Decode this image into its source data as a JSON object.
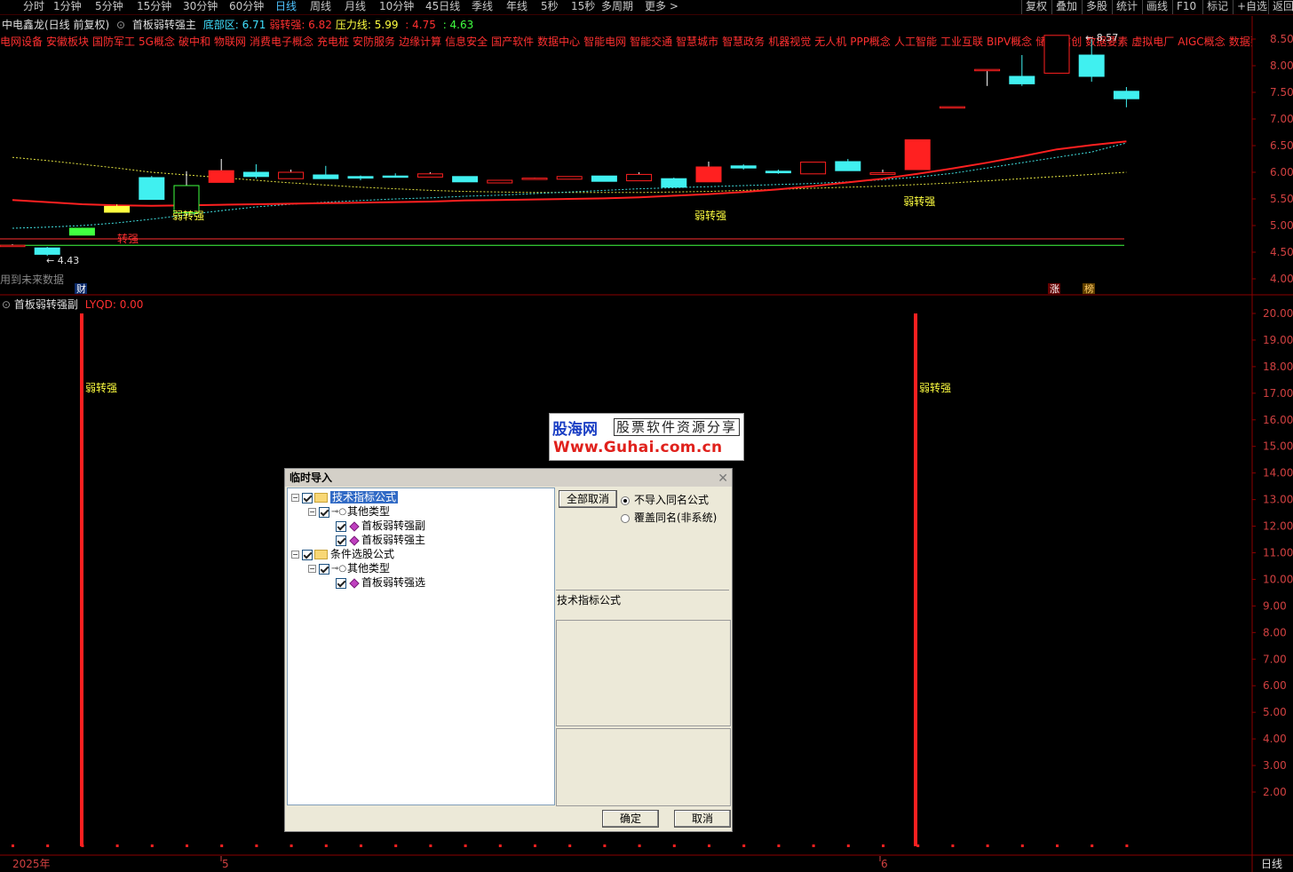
{
  "toolbar": {
    "periods": [
      "分时",
      "1分钟",
      "5分钟",
      "15分钟",
      "30分钟",
      "60分钟",
      "日线",
      "周线",
      "月线",
      "10分钟",
      "45日线",
      "季线",
      "年线",
      "5秒",
      "15秒",
      "多周期",
      "更多 >"
    ],
    "active_period": "日线",
    "right_buttons": [
      "复权",
      "叠加",
      "多股",
      "统计",
      "画线",
      "F10",
      "标记",
      "+自选",
      "返回"
    ]
  },
  "main_chart": {
    "stock": "中电鑫龙(日线 前复权)",
    "indicator": "首板弱转强主",
    "fields": [
      {
        "label": "底部区:",
        "value": "6.71",
        "color": "#40e0ff"
      },
      {
        "label": "弱转强:",
        "value": "6.82",
        "color": "#ff3030"
      },
      {
        "label": "压力线:",
        "value": "5.99",
        "color": "#ffff40"
      },
      {
        "label": "",
        "value": ": 4.75",
        "color": "#ff3030"
      },
      {
        "label": "",
        "value": ": 4.63",
        "color": "#40ff40"
      }
    ],
    "concepts": [
      "电网设备",
      "安徽板块",
      "国防军工",
      "5G概念",
      "破中和",
      "物联网",
      "消费电子概念",
      "充电桩",
      "安防服务",
      "边缘计算",
      "信息安全",
      "国产软件",
      "数据中心",
      "智能电网",
      "智能交通",
      "智慧城市",
      "智慧政务",
      "机器视觉",
      "无人机",
      "PPP概念",
      "人工智能",
      "工业互联",
      "BIPV概念",
      "储能",
      "信创",
      "数据要素",
      "虚拟电厂",
      "AIGC概念",
      "数据要素"
    ],
    "price_axis": [
      "8.50",
      "8.00",
      "7.50",
      "7.00",
      "6.50",
      "6.00",
      "5.50",
      "5.00",
      "4.50",
      "4.00"
    ],
    "signals": {
      "weak_to_strong": "弱转强",
      "turn_strong": "转强"
    },
    "high_label": "8.57",
    "low_label": "4.43",
    "future_note": "用到未来数据",
    "fin_marker": "财",
    "up_marker": "涨",
    "list_marker": "榜"
  },
  "sub_chart": {
    "indicator": "首板弱转强副",
    "field": "LYQD: 0.00",
    "axis": [
      "20.00",
      "19.00",
      "18.00",
      "17.00",
      "16.00",
      "15.00",
      "14.00",
      "13.00",
      "12.00",
      "11.00",
      "10.00",
      "9.00",
      "8.00",
      "7.00",
      "6.00",
      "5.00",
      "4.00",
      "3.00",
      "2.00"
    ],
    "signal_label": "弱转强"
  },
  "time_axis": {
    "year": "2025年",
    "m5": "5",
    "m6": "6",
    "period": "日线"
  },
  "watermark": {
    "brand": "股海网",
    "slogan": "股票软件资源分享",
    "url": "Www.Guhai.com.cn"
  },
  "dialog": {
    "title": "临时导入",
    "tree": [
      {
        "label": "技术指标公式",
        "level": 0,
        "kind": "folder",
        "selected": true
      },
      {
        "label": "其他类型",
        "level": 1,
        "kind": "key"
      },
      {
        "label": "首板弱转强副",
        "level": 2,
        "kind": "formula"
      },
      {
        "label": "首板弱转强主",
        "level": 2,
        "kind": "formula"
      },
      {
        "label": "条件选股公式",
        "level": 0,
        "kind": "folder"
      },
      {
        "label": "其他类型",
        "level": 1,
        "kind": "key"
      },
      {
        "label": "首板弱转强选",
        "level": 2,
        "kind": "formula"
      }
    ],
    "cancel_all": "全部取消",
    "radio_no_import": "不导入同名公式",
    "radio_overwrite": "覆盖同名(非系统)",
    "desc_title": "技术指标公式",
    "ok": "确定",
    "cancel": "取消"
  },
  "colors": {
    "up": "#ff2020",
    "down": "#40f0f0",
    "ma_red": "#ff2020",
    "ma_cyan": "#40e0e0",
    "ma_yellow": "#e0e040"
  },
  "chart_data": {
    "type": "candlestick",
    "candles": [
      {
        "o": 4.62,
        "h": 4.65,
        "l": 4.6,
        "c": 4.63
      },
      {
        "o": 4.58,
        "h": 4.6,
        "l": 4.43,
        "c": 4.46
      },
      {
        "o": 4.95,
        "h": 4.96,
        "l": 4.82,
        "c": 4.82
      },
      {
        "o": 5.36,
        "h": 5.4,
        "l": 5.25,
        "c": 5.25
      },
      {
        "o": 5.9,
        "h": 5.93,
        "l": 5.49,
        "c": 5.49
      },
      {
        "o": 5.24,
        "h": 6.02,
        "l": 5.18,
        "c": 5.75
      },
      {
        "o": 5.81,
        "h": 6.25,
        "l": 5.81,
        "c": 6.03
      },
      {
        "o": 6.0,
        "h": 6.15,
        "l": 5.88,
        "c": 5.92
      },
      {
        "o": 5.88,
        "h": 6.05,
        "l": 5.88,
        "c": 6.0
      },
      {
        "o": 5.95,
        "h": 6.12,
        "l": 5.88,
        "c": 5.88
      },
      {
        "o": 5.92,
        "h": 5.94,
        "l": 5.85,
        "c": 5.89
      },
      {
        "o": 5.93,
        "h": 5.98,
        "l": 5.9,
        "c": 5.92
      },
      {
        "o": 5.91,
        "h": 6.0,
        "l": 5.91,
        "c": 5.97
      },
      {
        "o": 5.92,
        "h": 5.92,
        "l": 5.82,
        "c": 5.82
      },
      {
        "o": 5.8,
        "h": 5.85,
        "l": 5.8,
        "c": 5.85
      },
      {
        "o": 5.88,
        "h": 5.9,
        "l": 5.88,
        "c": 5.89
      },
      {
        "o": 5.87,
        "h": 5.92,
        "l": 5.87,
        "c": 5.92
      },
      {
        "o": 5.93,
        "h": 5.93,
        "l": 5.83,
        "c": 5.83
      },
      {
        "o": 5.84,
        "h": 6.0,
        "l": 5.84,
        "c": 5.96
      },
      {
        "o": 5.88,
        "h": 5.9,
        "l": 5.72,
        "c": 5.72
      },
      {
        "o": 5.82,
        "h": 6.2,
        "l": 5.82,
        "c": 6.1
      },
      {
        "o": 6.12,
        "h": 6.15,
        "l": 6.05,
        "c": 6.08
      },
      {
        "o": 6.02,
        "h": 6.05,
        "l": 5.97,
        "c": 5.99
      },
      {
        "o": 5.97,
        "h": 6.19,
        "l": 5.97,
        "c": 6.19
      },
      {
        "o": 6.2,
        "h": 6.25,
        "l": 6.03,
        "c": 6.03
      },
      {
        "o": 5.96,
        "h": 6.05,
        "l": 5.96,
        "c": 5.99
      },
      {
        "o": 6.05,
        "h": 6.61,
        "l": 6.05,
        "c": 6.61
      },
      {
        "o": 7.23,
        "h": 7.23,
        "l": 7.23,
        "c": 7.23
      },
      {
        "o": 7.93,
        "h": 7.93,
        "l": 7.62,
        "c": 7.93
      },
      {
        "o": 7.8,
        "h": 8.2,
        "l": 7.62,
        "c": 7.66
      },
      {
        "o": 7.86,
        "h": 8.57,
        "l": 7.86,
        "c": 8.57
      },
      {
        "o": 8.2,
        "h": 8.5,
        "l": 7.7,
        "c": 7.8
      },
      {
        "o": 7.52,
        "h": 7.6,
        "l": 7.22,
        "c": 7.38
      }
    ],
    "ma_red": [
      5.48,
      5.44,
      5.4,
      5.38,
      5.37,
      5.38,
      5.39,
      5.4,
      5.41,
      5.42,
      5.43,
      5.44,
      5.45,
      5.47,
      5.48,
      5.49,
      5.5,
      5.51,
      5.53,
      5.56,
      5.59,
      5.63,
      5.68,
      5.74,
      5.81,
      5.88,
      5.97,
      6.07,
      6.18,
      6.3,
      6.43,
      6.51,
      6.58
    ],
    "ma_cyan": [
      4.95,
      4.97,
      5.0,
      5.05,
      5.12,
      5.2,
      5.28,
      5.35,
      5.4,
      5.44,
      5.47,
      5.5,
      5.52,
      5.55,
      5.57,
      5.6,
      5.63,
      5.66,
      5.69,
      5.71,
      5.73,
      5.75,
      5.77,
      5.79,
      5.82,
      5.86,
      5.91,
      5.98,
      6.08,
      6.18,
      6.28,
      6.38,
      6.55
    ],
    "ma_yellow": [
      6.28,
      6.22,
      6.15,
      6.08,
      6.0,
      5.95,
      5.9,
      5.85,
      5.8,
      5.76,
      5.72,
      5.69,
      5.66,
      5.64,
      5.63,
      5.62,
      5.62,
      5.62,
      5.62,
      5.63,
      5.64,
      5.66,
      5.68,
      5.7,
      5.72,
      5.74,
      5.77,
      5.8,
      5.84,
      5.88,
      5.92,
      5.96,
      6.0
    ],
    "level_lines": [
      4.75,
      4.63
    ],
    "sub_signals_at": [
      2,
      26
    ],
    "sub_ylim": [
      1,
      20
    ],
    "price_ylim": [
      3.9,
      8.6
    ]
  }
}
